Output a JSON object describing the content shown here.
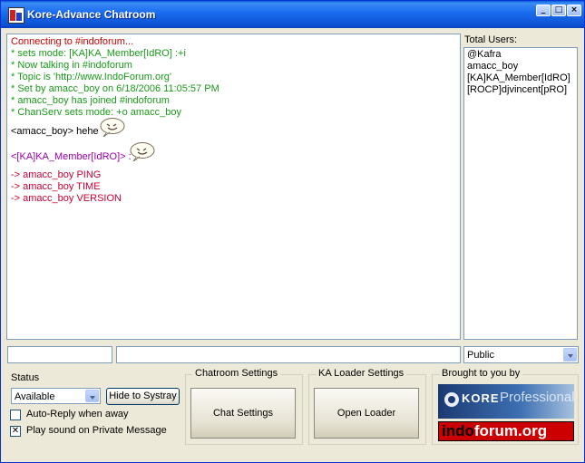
{
  "window": {
    "title": "Kore-Advance Chatroom",
    "controls": {
      "minimize": "_",
      "maximize": "□",
      "close": "×"
    }
  },
  "chat": {
    "lines": [
      {
        "text": "Connecting to #indoforum...",
        "color": "#cc0000"
      },
      {
        "text": "* sets mode: [KA]KA_Member[IdRO] :+i",
        "color": "#1a9a1a"
      },
      {
        "text": "* Now talking in #indoforum",
        "color": "#1a9a1a"
      },
      {
        "text": "* Topic is 'http://www.IndoForum.org'",
        "color": "#1a9a1a"
      },
      {
        "text": "* Set by amacc_boy on 6/18/2006 11:05:57 PM",
        "color": "#1a9a1a"
      },
      {
        "text": "* amacc_boy has joined #indoforum",
        "color": "#1a9a1a"
      },
      {
        "text": "* ChanServ sets mode: +o amacc_boy",
        "color": "#1a9a1a"
      },
      {
        "text": "<amacc_boy> hehe",
        "color": "#000000",
        "emoticon": "smiley-icon"
      },
      {
        "text": "<[KA]KA_Member[IdRO]> :",
        "color": "#9900aa",
        "emoticon": "smiley-icon"
      },
      {
        "text": "-> amacc_boy PING",
        "color": "#cc0033"
      },
      {
        "text": "-> amacc_boy TIME",
        "color": "#cc0033"
      },
      {
        "text": "-> amacc_boy VERSION",
        "color": "#cc0033"
      }
    ]
  },
  "users": {
    "label": "Total Users:",
    "items": [
      "@Kafra",
      "amacc_boy",
      "[KA]KA_Member[IdRO]",
      "[ROCP]djvincent[pRO]"
    ]
  },
  "input": {
    "nick_value": "",
    "message_value": "",
    "target_select": "Public"
  },
  "status": {
    "label": "Status",
    "selected": "Available",
    "hide_button": "Hide to Systray",
    "auto_reply_label": "Auto-Reply when away",
    "auto_reply_checked": false,
    "play_sound_label": "Play sound on Private Message",
    "play_sound_checked": true,
    "play_sound_mark": "✕"
  },
  "chatroom_settings": {
    "legend": "Chatroom Settings",
    "button": "Chat Settings"
  },
  "ka_loader": {
    "legend": "KA Loader Settings",
    "button": "Open Loader"
  },
  "sponsor": {
    "legend": "Brought to you by",
    "kore_word": "KORE",
    "kore_sub": "Professional",
    "indo_a": "indo",
    "indo_b": "forum.org"
  }
}
